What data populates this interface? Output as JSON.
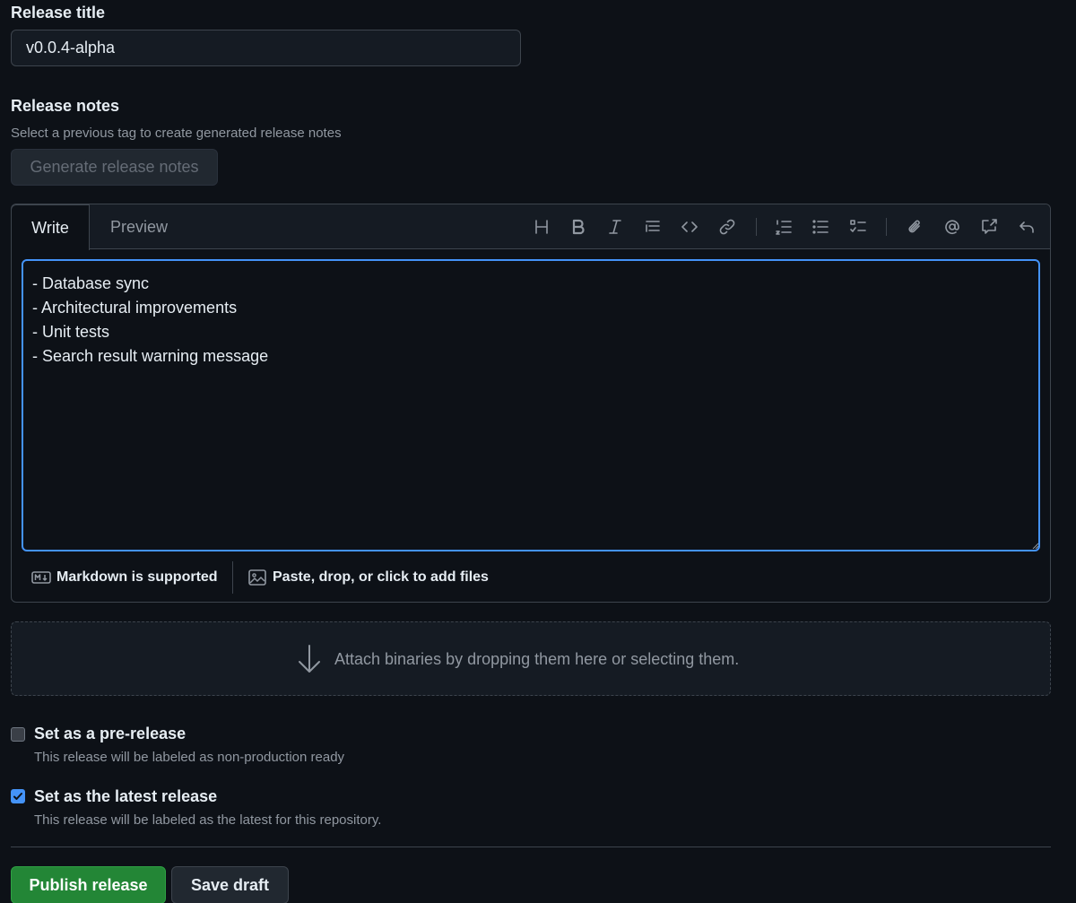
{
  "release_title": {
    "label": "Release title",
    "value": "v0.0.4-alpha"
  },
  "release_notes": {
    "label": "Release notes",
    "hint": "Select a previous tag to create generated release notes",
    "generate_button": "Generate release notes",
    "tabs": {
      "write": "Write",
      "preview": "Preview"
    },
    "toolbar_icons": [
      "heading-icon",
      "bold-icon",
      "italic-icon",
      "quote-icon",
      "code-icon",
      "link-icon",
      "numbered-list-icon",
      "unordered-list-icon",
      "task-list-icon",
      "attach-icon",
      "mention-icon",
      "cross-reference-icon",
      "undo-icon"
    ],
    "body": "- Database sync\n- Architectural improvements\n- Unit tests\n- Search result warning message",
    "markdown_note": "Markdown is supported",
    "files_note": "Paste, drop, or click to add files"
  },
  "binaries": {
    "text": "Attach binaries by dropping them here or selecting them."
  },
  "prerelease": {
    "title": "Set as a pre-release",
    "description": "This release will be labeled as non-production ready",
    "checked": false
  },
  "latest": {
    "title": "Set as the latest release",
    "description": "This release will be labeled as the latest for this repository.",
    "checked": true
  },
  "actions": {
    "publish": "Publish release",
    "save_draft": "Save draft"
  },
  "colors": {
    "background": "#0d1117",
    "focus_border": "#4493f8",
    "publish_green": "#238636"
  }
}
